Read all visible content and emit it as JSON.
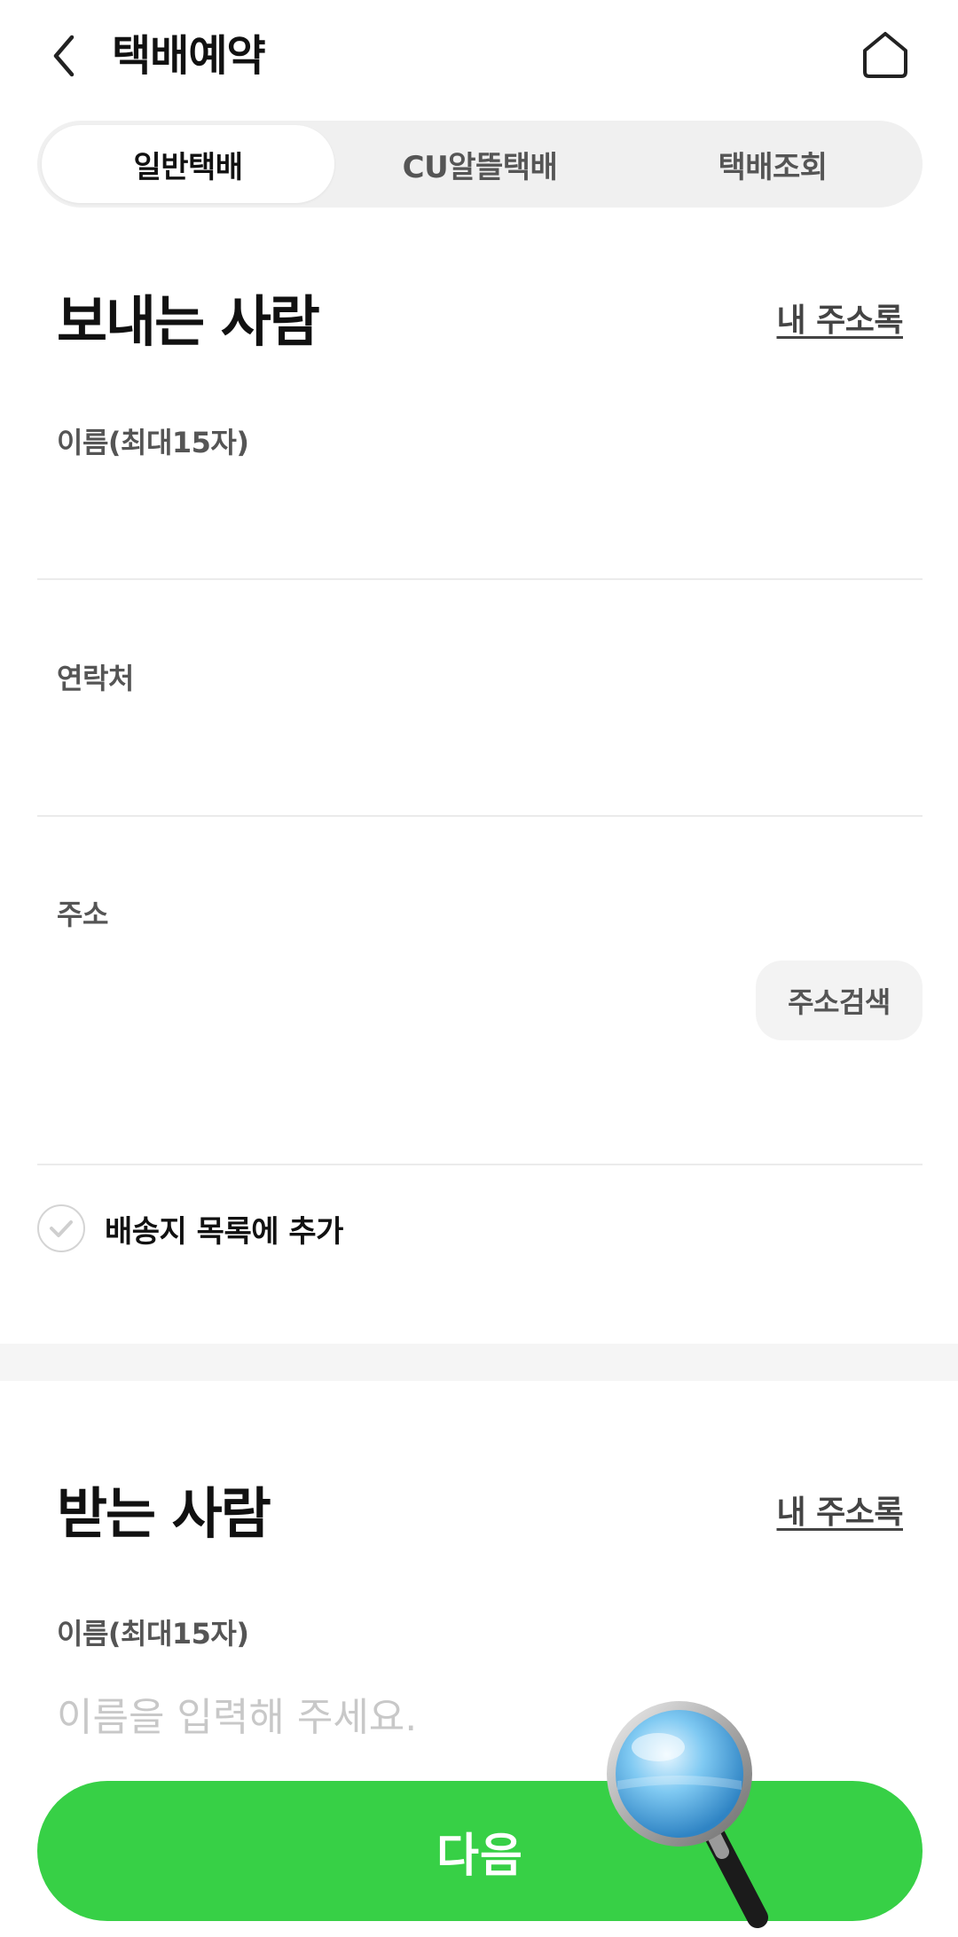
{
  "header": {
    "title": "택배예약",
    "back_icon": "chevron-left-icon",
    "home_icon": "home-icon"
  },
  "tabs": [
    {
      "label": "일반택배",
      "active": true
    },
    {
      "label": "CU알뜰택배",
      "active": false
    },
    {
      "label": "택배조회",
      "active": false
    }
  ],
  "sender": {
    "title": "보내는 사람",
    "address_book": "내 주소록",
    "name_label": "이름(최대15자)",
    "name_value": "",
    "phone_label": "연락처",
    "phone_value": "",
    "address_label": "주소",
    "address_search_button": "주소검색",
    "add_to_list_label": "배송지 목록에 추가",
    "add_to_list_checked": false
  },
  "receiver": {
    "title": "받는 사람",
    "address_book": "내 주소록",
    "name_label": "이름(최대15자)",
    "name_placeholder": "이름을 입력해 주세요."
  },
  "footer": {
    "next_button": "다음"
  },
  "colors": {
    "accent_green": "#37d046",
    "tab_bg": "#f0f0f0",
    "divider": "#ebebeb",
    "placeholder": "#c8c8c8"
  }
}
